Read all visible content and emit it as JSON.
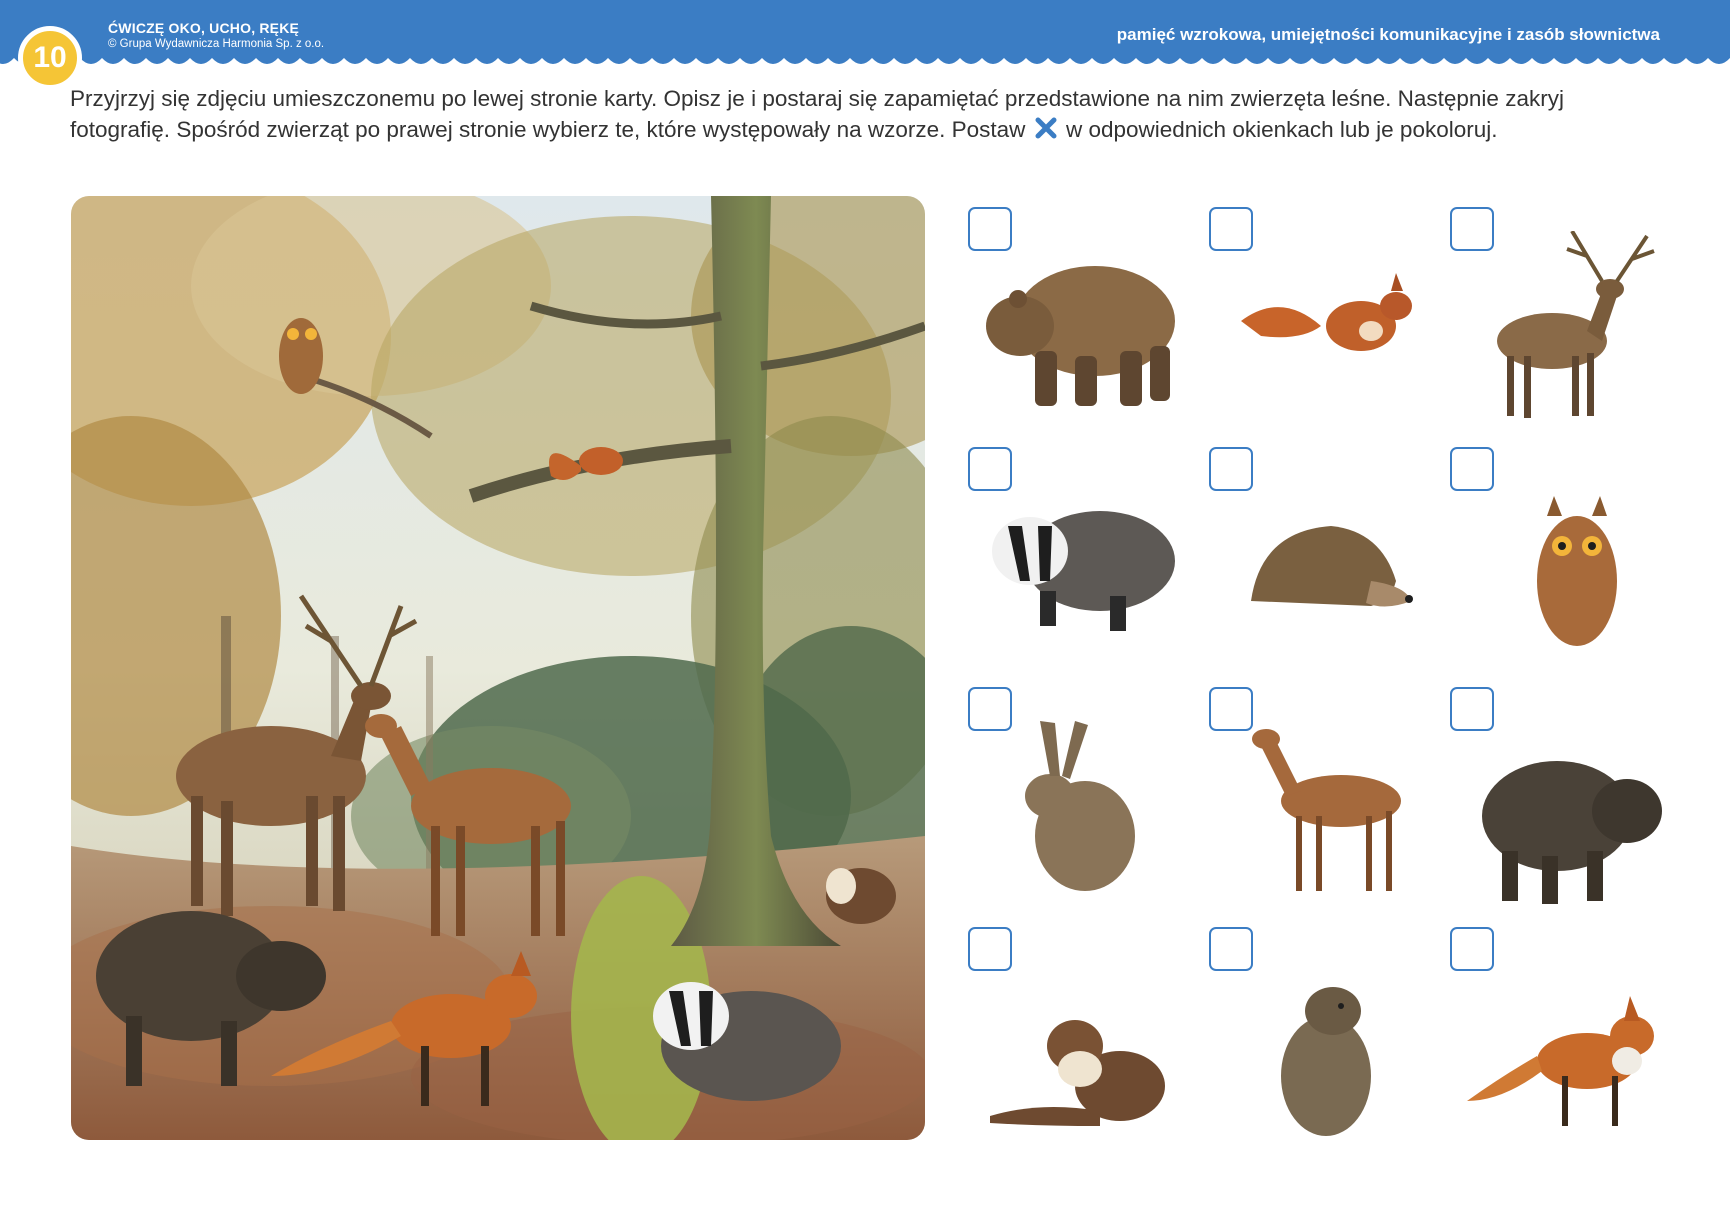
{
  "header": {
    "page_number": "10",
    "series_title": "ĆWICZĘ OKO, UCHO, RĘKĘ",
    "copyright": "© Grupa Wydawnicza Harmonia Sp. z o.o.",
    "skills": "pamięć wzrokowa, umiejętności komunikacyjne i zasób słownictwa",
    "colors": {
      "band": "#3b7dc4",
      "badge": "#f5c536"
    }
  },
  "instructions": {
    "part1": "Przyjrzyj się zdjęciu umieszczonemu po lewej stronie karty. Opisz je i postaraj się zapamiętać przedstawione na nim zwierzęta leśne. Następnie zakryj fotografię. Spośród zwierząt po prawej stronie wybierz te, które występowały na wzorze. Postaw",
    "icon": "x-mark-icon",
    "part2": "w odpowiednich okienkach lub je pokoloruj."
  },
  "photo": {
    "animals": [
      "owl",
      "squirrel",
      "red-deer-stag",
      "roe-deer",
      "wild-boar",
      "fox",
      "badger",
      "marten"
    ]
  },
  "choices": [
    {
      "animal": "bear",
      "checked": false
    },
    {
      "animal": "squirrel",
      "checked": false
    },
    {
      "animal": "red-deer-stag",
      "checked": false
    },
    {
      "animal": "badger",
      "checked": false
    },
    {
      "animal": "hedgehog",
      "checked": false
    },
    {
      "animal": "owl",
      "checked": false
    },
    {
      "animal": "hare",
      "checked": false
    },
    {
      "animal": "roe-deer",
      "checked": false
    },
    {
      "animal": "wild-boar",
      "checked": false
    },
    {
      "animal": "marten",
      "checked": false
    },
    {
      "animal": "marmot",
      "checked": false
    },
    {
      "animal": "fox",
      "checked": false
    }
  ]
}
